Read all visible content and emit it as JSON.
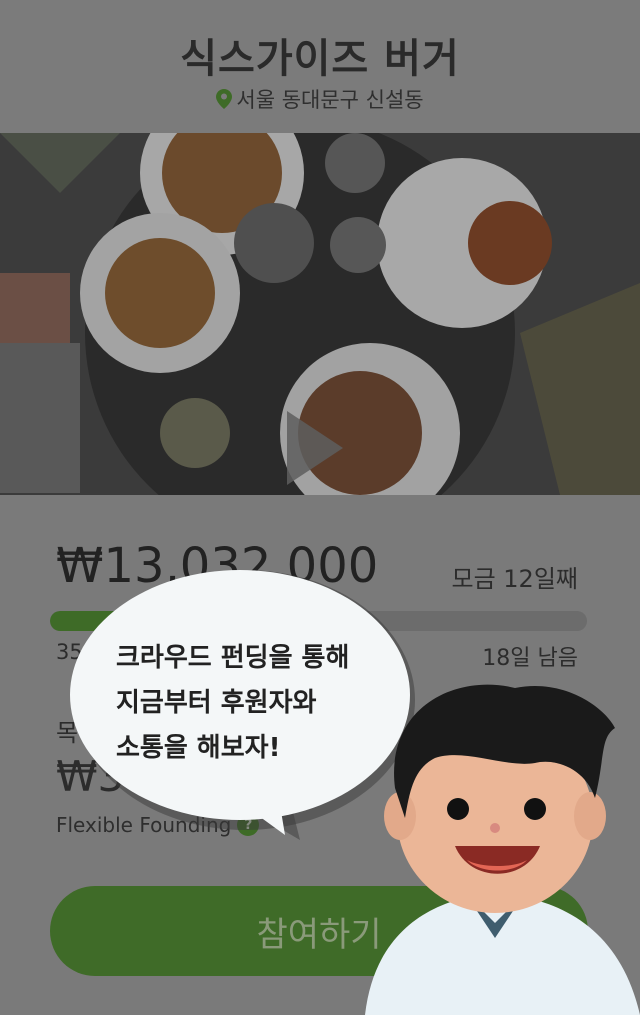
{
  "header": {
    "title": "식스가이즈 버거",
    "location": "서울 동대문구 신설동"
  },
  "video": {
    "play_icon": "play-icon"
  },
  "funding": {
    "amount": "₩13,032,000",
    "days_label": "모금 12일째",
    "progress_percent": 35,
    "percent_text": "35",
    "remaining_label": "18일 남음",
    "goal_label": "목",
    "goal_amount": "₩37",
    "flexible_label": "Flexible Founding",
    "help_glyph": "?"
  },
  "bubble": {
    "line1": "크라우드 펀딩을 통해",
    "line2": "지금부터 후원자와",
    "line3": "소통을 해보자!"
  },
  "cta": {
    "label": "참여하기"
  },
  "colors": {
    "accent": "#3e6b27",
    "overlay": "#7a7a7a"
  }
}
